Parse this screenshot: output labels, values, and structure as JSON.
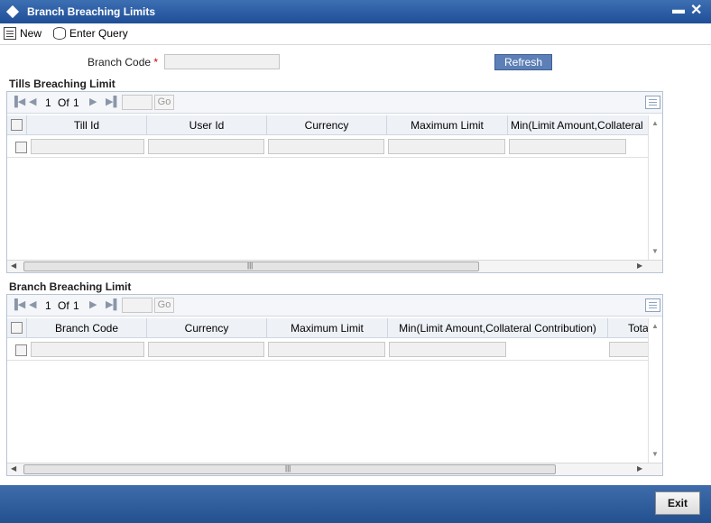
{
  "window": {
    "title": "Branch Breaching Limits",
    "minimize": "▬",
    "close": "✕"
  },
  "toolbar": {
    "new_label": "New",
    "query_label": "Enter Query"
  },
  "form": {
    "branch_code_label": "Branch Code",
    "required_mark": "*",
    "branch_code_value": "",
    "refresh_label": "Refresh"
  },
  "tills": {
    "title": "Tills Breaching Limit",
    "pager": {
      "current": "1",
      "of": "Of",
      "total": "1",
      "go": "Go"
    },
    "columns": [
      "Till Id",
      "User Id",
      "Currency",
      "Maximum Limit",
      "Min(Limit Amount,Collateral"
    ]
  },
  "branch": {
    "title": "Branch Breaching Limit",
    "pager": {
      "current": "1",
      "of": "Of",
      "total": "1",
      "go": "Go"
    },
    "columns": [
      "Branch Code",
      "Currency",
      "Maximum Limit",
      "Min(Limit Amount,Collateral Contribution)",
      "Tota"
    ]
  },
  "footer": {
    "exit_label": "Exit"
  },
  "icons": {
    "first": "first-page-icon",
    "prev": "prev-page-icon",
    "next": "next-page-icon",
    "last": "last-page-icon"
  },
  "colors": {
    "title_bar": "#2a5aa3",
    "footer": "#2f5c9c",
    "refresh": "#5b7fb6"
  }
}
